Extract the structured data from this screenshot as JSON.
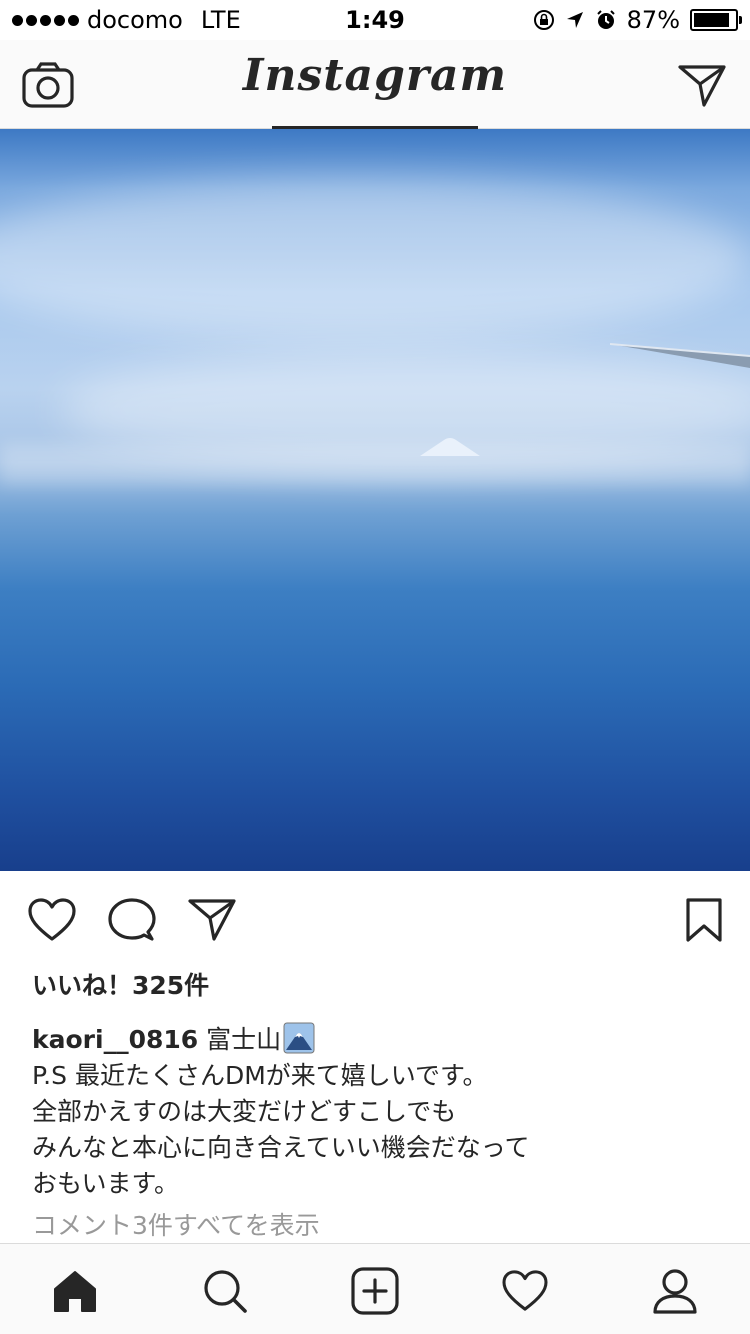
{
  "status_bar": {
    "carrier": "docomo",
    "network": "LTE",
    "time": "1:49",
    "battery": "87%",
    "battery_level": 0.87
  },
  "navbar": {
    "title": "Instagram"
  },
  "post": {
    "likes": "いいね！325件",
    "username": "kaori__0816",
    "caption_first_line": "富士山",
    "caption_lines": [
      "P.S 最近たくさんDMが来て嬉しいです。",
      "全部かえすのは大変だけどすこしでも",
      "みんなと本心に向き合えていい機会だなって",
      "おもいます。"
    ],
    "view_comments": "コメント3件すべてを表示"
  },
  "icons": {
    "camera": "camera-icon",
    "direct": "paper-plane-icon",
    "like": "heart-icon",
    "comment": "comment-bubble-icon",
    "share": "paper-plane-icon",
    "save": "bookmark-icon",
    "home": "home-icon",
    "search": "search-icon",
    "add": "plus-square-icon",
    "activity": "heart-icon",
    "profile": "person-icon"
  },
  "colors": {
    "text": "#262626",
    "secondary": "#999999",
    "divider": "#dbdbdb"
  }
}
